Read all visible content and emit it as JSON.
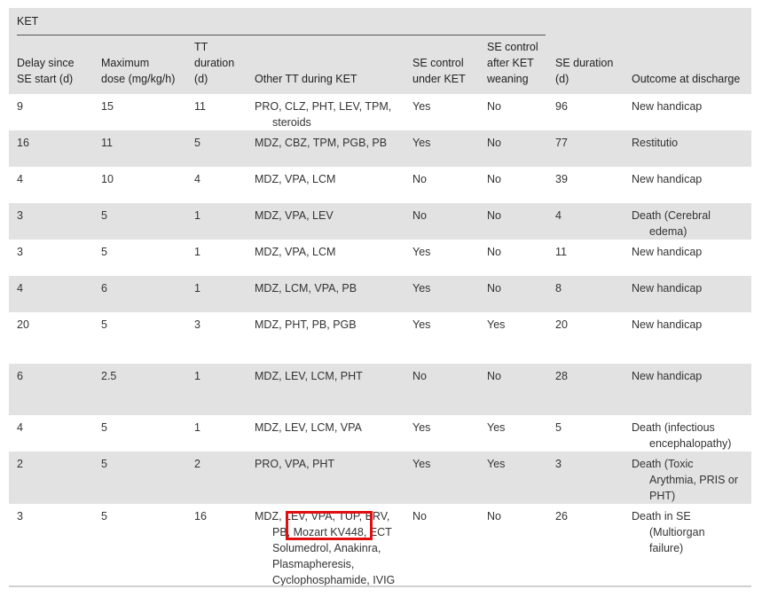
{
  "table": {
    "group_label": "KET",
    "headers": [
      {
        "lines": [
          "Delay since",
          "SE start (d)"
        ]
      },
      {
        "lines": [
          "Maximum",
          "dose (mg/kg/h)"
        ]
      },
      {
        "lines": [
          "TT",
          "duration",
          "(d)"
        ]
      },
      {
        "lines": [
          "Other TT during KET"
        ]
      },
      {
        "lines": [
          "SE control",
          "under KET"
        ]
      },
      {
        "lines": [
          "SE control",
          "after KET",
          "weaning"
        ]
      },
      {
        "lines": [
          "SE duration",
          "(d)"
        ]
      },
      {
        "lines": [
          "Outcome at discharge"
        ]
      }
    ],
    "rows": [
      {
        "delay": "9",
        "dose": "15",
        "tt": "11",
        "other": [
          "PRO, CLZ, PHT, LEV, TPM,",
          "steroids"
        ],
        "under": "Yes",
        "after": "No",
        "se": "96",
        "outcome": [
          "New handicap"
        ]
      },
      {
        "delay": "16",
        "dose": "11",
        "tt": "5",
        "other": [
          "MDZ, CBZ, TPM, PGB, PB"
        ],
        "under": "Yes",
        "after": "No",
        "se": "77",
        "outcome": [
          "Restitutio"
        ]
      },
      {
        "delay": "4",
        "dose": "10",
        "tt": "4",
        "other": [
          "MDZ, VPA, LCM"
        ],
        "under": "No",
        "after": "No",
        "se": "39",
        "outcome": [
          "New handicap"
        ]
      },
      {
        "delay": "3",
        "dose": "5",
        "tt": "1",
        "other": [
          "MDZ, VPA, LEV"
        ],
        "under": "No",
        "after": "No",
        "se": "4",
        "outcome": [
          "Death (Cerebral",
          "edema)"
        ]
      },
      {
        "delay": "3",
        "dose": "5",
        "tt": "1",
        "other": [
          "MDZ, VPA, LCM"
        ],
        "under": "Yes",
        "after": "No",
        "se": "11",
        "outcome": [
          "New handicap"
        ]
      },
      {
        "delay": "4",
        "dose": "6",
        "tt": "1",
        "other": [
          "MDZ, LCM, VPA, PB"
        ],
        "under": "Yes",
        "after": "No",
        "se": "8",
        "outcome": [
          "New handicap"
        ]
      },
      {
        "delay": "20",
        "dose": "5",
        "tt": "3",
        "other": [
          "MDZ, PHT, PB, PGB"
        ],
        "under": "Yes",
        "after": "Yes",
        "se": "20",
        "outcome": [
          "New handicap"
        ]
      },
      {
        "delay": "6",
        "dose": "2.5",
        "tt": "1",
        "other": [
          "MDZ, LEV, LCM, PHT"
        ],
        "under": "No",
        "after": "No",
        "se": "28",
        "outcome": [
          "New handicap"
        ]
      },
      {
        "delay": "4",
        "dose": "5",
        "tt": "1",
        "other": [
          "MDZ, LEV, LCM, VPA"
        ],
        "under": "Yes",
        "after": "Yes",
        "se": "5",
        "outcome": [
          "Death (infectious",
          "encephalopathy)"
        ]
      },
      {
        "delay": "2",
        "dose": "5",
        "tt": "2",
        "other": [
          "PRO, VPA, PHT"
        ],
        "under": "Yes",
        "after": "Yes",
        "se": "3",
        "outcome": [
          "Death (Toxic",
          "Arythmia, PRIS or",
          "PHT)"
        ]
      },
      {
        "delay": "3",
        "dose": "5",
        "tt": "16",
        "other": [
          "MDZ, LEV, VPA, TUP, BRV,",
          "PB, Mozart KV448, ECT",
          "Solumedrol, Anakinra,",
          "Plasmapheresis,",
          "Cyclophosphamide, IVIG"
        ],
        "under": "No",
        "after": "No",
        "se": "26",
        "outcome": [
          "Death in SE",
          "(Multiorgan",
          "failure)"
        ]
      }
    ]
  },
  "highlight": {
    "text": "Mozart KV448",
    "color": "#e01010"
  }
}
